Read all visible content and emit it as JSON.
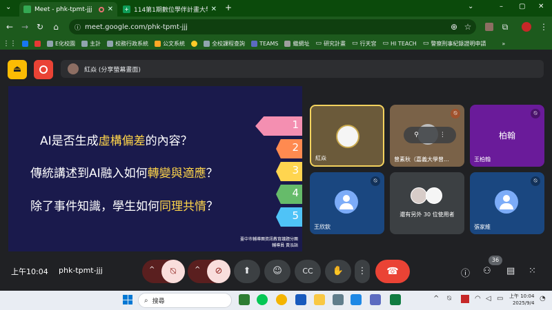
{
  "browser": {
    "tabs": [
      {
        "title": "Meet - phk-tpmt-jjj",
        "active": true
      },
      {
        "title": "114第1期數位學伴計畫大學伴學",
        "active": false
      }
    ],
    "new_tab": "+",
    "url": "meet.google.com/phk-tpmt-jjj",
    "window_controls": [
      "⌄",
      "–",
      "▢",
      "✕"
    ],
    "bookmarks": [
      "E化校園",
      "主計",
      "校務行政系統",
      "公文系統",
      "全校課程查詢",
      "TEAMS",
      "繼網址",
      "研究計畫",
      "行天宮",
      "HI TEACH",
      "警察刑事紀錄證明申請"
    ],
    "bookmarks_more": "»"
  },
  "meet": {
    "presenter_label": "紅焱 (分享螢幕畫面)",
    "slide": {
      "lines": [
        {
          "pre": "AI是否生成",
          "hl": "虛構偏差",
          "post": "的內容？"
        },
        {
          "pre": "傳統講述到AI融入如何",
          "hl": "轉變與適應",
          "post": "？"
        },
        {
          "pre": "除了事件知識，學生如何",
          "hl": "同理共情",
          "post": "？"
        }
      ],
      "numbers": [
        "1",
        "2",
        "3",
        "4",
        "5"
      ],
      "colors": [
        "#f48fb1",
        "#ff8a50",
        "#ffd54f",
        "#66bb6a",
        "#4fc3f7"
      ],
      "footer_org": "臺中市輔導團資訊教育議題分團",
      "footer_person": "輔導員 黃泓諳"
    },
    "participants": [
      {
        "name": "紅焱",
        "muted": false
      },
      {
        "name": "曾素秋（嘉義大學曾...",
        "muted": true
      },
      {
        "name": "王柏翰",
        "initials": "柏翰",
        "muted": true
      },
      {
        "name": "王欣欽",
        "muted": true
      },
      {
        "name": "還有另外 30 位使用者",
        "muted": false
      },
      {
        "name": "張家維",
        "muted": true
      }
    ],
    "time": "上午10:04",
    "meeting_code": "phk-tpmt-jjj",
    "participant_count": "36"
  },
  "taskbar": {
    "search_placeholder": "搜尋",
    "clock_time": "上午 10:04",
    "clock_date": "2025/9/4"
  }
}
